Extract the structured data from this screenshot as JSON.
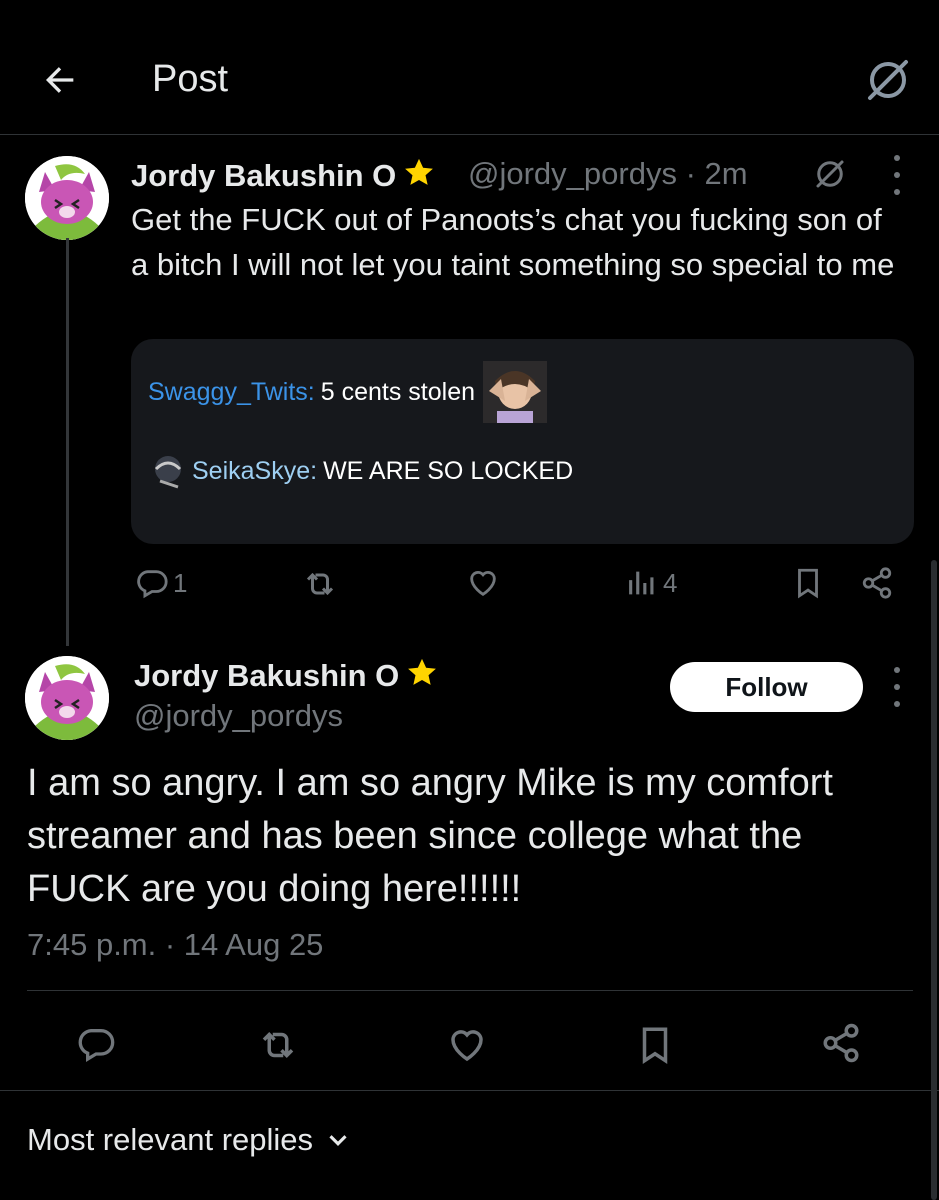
{
  "header": {
    "title": "Post"
  },
  "reply": {
    "author_name": "Jordy Bakushin O",
    "handle": "@jordy_pordys",
    "time": "· 2m",
    "text": "Get the FUCK out of Panoots’s chat you fucking son of a bitch I will not let you taint something so special to me",
    "chat": [
      {
        "user": "Swaggy_Twits:",
        "message": "5 cents stolen",
        "user_color": "#3b93e8"
      },
      {
        "user": "SeikaSkye:",
        "message": "WE ARE SO LOCKED",
        "user_color": "#9ecff2"
      }
    ],
    "actions": {
      "replies": "1",
      "reposts": "",
      "likes": "",
      "views": "4"
    }
  },
  "post": {
    "author_name": "Jordy Bakushin O",
    "handle": "@jordy_pordys",
    "follow_label": "Follow",
    "text": "I am so angry. I am so angry Mike is my comfort streamer and has been since college what the FUCK are you doing here!!!!!!",
    "timestamp": "7:45 p.m. · 14 Aug 25"
  },
  "replies_sort": {
    "label": "Most relevant replies"
  },
  "colors": {
    "background": "#000000",
    "text": "#e7e9ea",
    "muted": "#71767b",
    "accent": "#1d9bf0",
    "star": "#ffd400"
  }
}
